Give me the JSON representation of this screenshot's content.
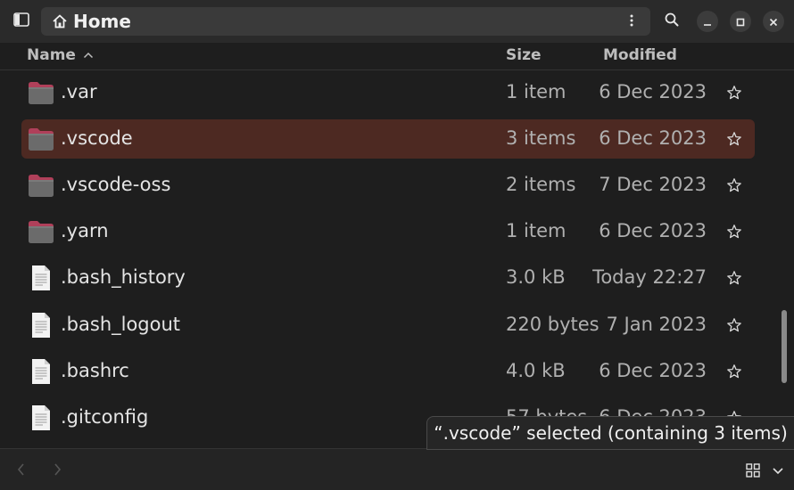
{
  "header": {
    "location": "Home",
    "icons": {
      "sidebar": "sidebar-toggle-icon",
      "home": "home-icon",
      "menu": "kebab-menu-icon",
      "search": "search-icon",
      "minimize": "minimize-icon",
      "maximize": "maximize-icon",
      "close": "close-icon"
    }
  },
  "columns": {
    "name": "Name",
    "size": "Size",
    "modified": "Modified",
    "sort_direction": "ascending"
  },
  "files": [
    {
      "name": ".var",
      "type": "folder",
      "size": "1 item",
      "modified": "6 Dec 2023",
      "selected": false
    },
    {
      "name": ".vscode",
      "type": "folder",
      "size": "3 items",
      "modified": "6 Dec 2023",
      "selected": true
    },
    {
      "name": ".vscode-oss",
      "type": "folder",
      "size": "2 items",
      "modified": "7 Dec 2023",
      "selected": false
    },
    {
      "name": ".yarn",
      "type": "folder",
      "size": "1 item",
      "modified": "6 Dec 2023",
      "selected": false
    },
    {
      "name": ".bash_history",
      "type": "file",
      "size": "3.0 kB",
      "modified": "Today 22:27",
      "selected": false
    },
    {
      "name": ".bash_logout",
      "type": "file",
      "size": "220 bytes",
      "modified": "7 Jan 2023",
      "selected": false
    },
    {
      "name": ".bashrc",
      "type": "file",
      "size": "4.0 kB",
      "modified": "6 Dec 2023",
      "selected": false
    },
    {
      "name": ".gitconfig",
      "type": "file",
      "size": "57 bytes",
      "modified": "6 Dec 2023",
      "selected": false
    }
  ],
  "status": {
    "text": "“.vscode” selected (containing 3 items)"
  },
  "colors": {
    "selection": "#4d2922",
    "folder": "#6b6b6b",
    "folder_tab": "#b0405a",
    "background": "#1e1e1e"
  }
}
